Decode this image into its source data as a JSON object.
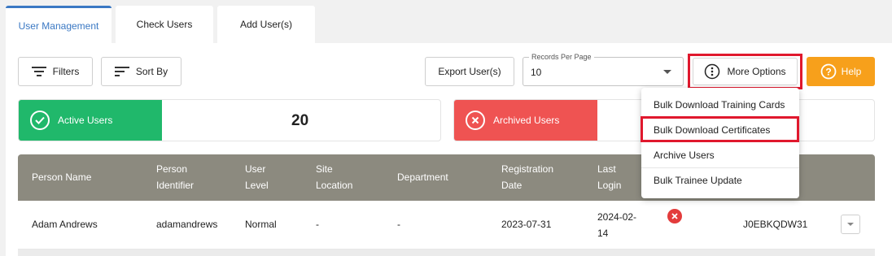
{
  "tabs": [
    {
      "label": "User Management"
    },
    {
      "label": "Check Users"
    },
    {
      "label": "Add User(s)"
    }
  ],
  "toolbar": {
    "filters_label": "Filters",
    "sort_label": "Sort By",
    "export_label": "Export User(s)",
    "records_per_page_label": "Records Per Page",
    "records_per_page_value": "10",
    "more_options_label": "More Options",
    "help_label": "Help"
  },
  "cards": {
    "active_label": "Active Users",
    "active_count": "20",
    "archived_label": "Archived Users"
  },
  "table": {
    "headers": [
      {
        "line1": "Person Name",
        "line2": ""
      },
      {
        "line1": "Person",
        "line2": "Identifier"
      },
      {
        "line1": "User",
        "line2": "Level"
      },
      {
        "line1": "Site",
        "line2": "Location"
      },
      {
        "line1": "Department",
        "line2": ""
      },
      {
        "line1": "Registration",
        "line2": "Date"
      },
      {
        "line1": "Last",
        "line2": "Login"
      }
    ],
    "rows": [
      {
        "person_name": "Adam Andrews",
        "person_identifier": "adamandrews",
        "user_level": "Normal",
        "site_location": "-",
        "department": "-",
        "registration_date": "2023-07-31",
        "last_login_line1": "2024-02-",
        "last_login_line2": "14",
        "code": "J0EBKQDW31"
      }
    ]
  },
  "dropdown": {
    "items": [
      {
        "label": "Bulk Download Training Cards"
      },
      {
        "label": "Bulk Download Certificates"
      },
      {
        "label": "Archive Users"
      },
      {
        "label": "Bulk Trainee Update"
      }
    ]
  },
  "colors": {
    "accent": "#3a78c3",
    "active": "#20b86b",
    "archived": "#ef5352",
    "help": "#f7a01b",
    "highlight": "#e0182d",
    "table_header": "#8c8a7f"
  }
}
